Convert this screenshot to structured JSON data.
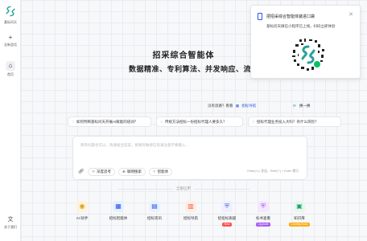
{
  "sidebar": {
    "logo_text": "基标问天",
    "new_chat_label": "全新会话",
    "home_label": "首页",
    "feedback_label": "关于我们"
  },
  "main": {
    "title": "招采综合智能体",
    "subtitle": "数据精准、专利算法、并发响应、流程专",
    "hint_prefix": "没有思路？看看",
    "hint_link": "招标导航",
    "swap_label": "换一换",
    "questions": [
      "如何判断基标问天开展AI赋能的培训？",
      "传统方法招标一份招标代理人要多久？",
      "招标代理业务投入大吗？有什么风险？"
    ],
    "input": {
      "placeholder": "简单问题也可以，快速给出答案，如果有敏感信息请注意不要输入…",
      "count_text": "Enter(+) | 发送，Shift(⇧) + Enter 换行"
    },
    "tools": [
      "深度思考",
      "联网搜索",
      "智能体"
    ],
    "section_label": "全部应用",
    "apps": [
      {
        "label": "AI 助手",
        "icon": "robot-icon",
        "badge": ""
      },
      {
        "label": "招标智能体",
        "icon": "grid-icon",
        "badge": ""
      },
      {
        "label": "招标资讯",
        "icon": "news-icon",
        "badge": ""
      },
      {
        "label": "招标导航",
        "icon": "nav-icon",
        "badge": ""
      },
      {
        "label": "招投标质疑",
        "icon": "shield-icon",
        "badge": "New"
      },
      {
        "label": "标书查重",
        "icon": "check-shield-icon",
        "badge": "Upgrade"
      },
      {
        "label": "知识库",
        "icon": "book-icon",
        "badge": "Coming Soon"
      }
    ]
  },
  "popup": {
    "title": "把招采综合智能体装进口袋",
    "subtitle": "基标问天微信小程序已上线，扫码立即体验"
  },
  "colors": {
    "accent": "#2f54eb",
    "brand_green": "#1aa06d",
    "badge_new": "#ff4d4f",
    "badge_upgrade": "#a855f7",
    "badge_soon": "#faad14"
  }
}
